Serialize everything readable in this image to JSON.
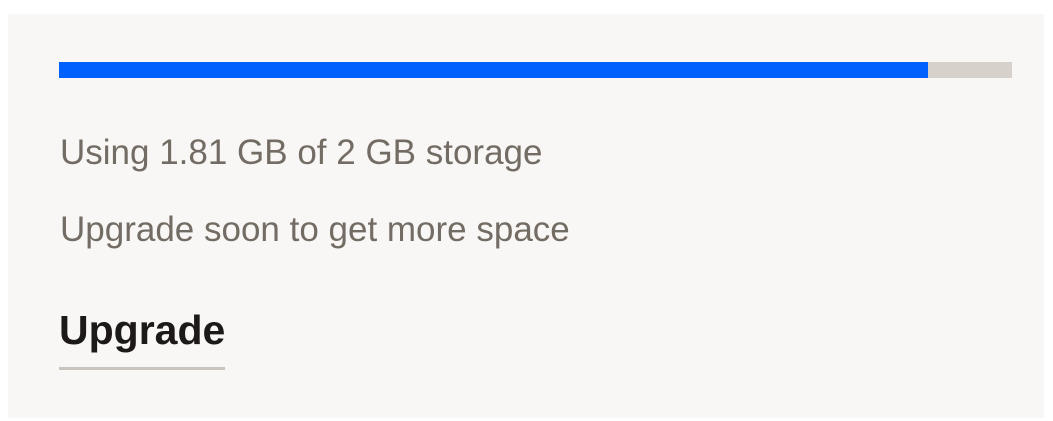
{
  "storage": {
    "used_fraction": 0.912,
    "usage_text": "Using 1.81 GB of 2 GB storage",
    "hint_text": "Upgrade soon to get more space",
    "upgrade_label": "Upgrade",
    "colors": {
      "fill": "#0061fe",
      "track": "#d6d2cb",
      "panel_background": "#f8f7f5",
      "secondary_text": "#736c64",
      "primary_text": "#1e1919"
    }
  }
}
